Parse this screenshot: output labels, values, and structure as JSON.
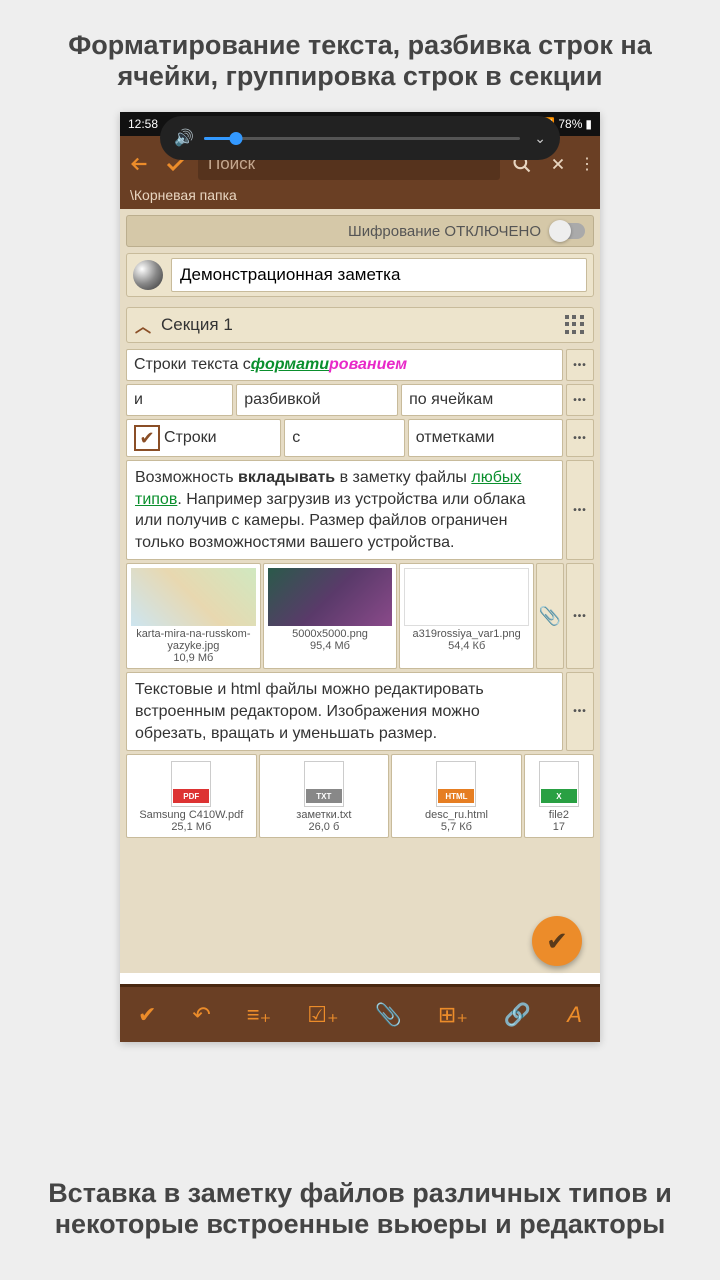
{
  "captions": {
    "top": "Форматирование текста, разбивка строк на ячейки, группировка строк в секции",
    "bottom": "Вставка в заметку файлов различных типов и некоторые встроенные вьюеры и редакторы"
  },
  "statusbar": {
    "time": "12:58",
    "battery": "78%"
  },
  "toolbar": {
    "search_placeholder": "Поиск"
  },
  "breadcrumb": "\\Корневая папка",
  "encryption": {
    "label": "Шифрование ОТКЛЮЧЕНО"
  },
  "note_title": "Демонстрационная заметка",
  "section": {
    "title": "Секция 1"
  },
  "rows": {
    "r1_prefix": "Строки текста с ",
    "r1_fmt1": "формати",
    "r1_fmt2": "рованием",
    "r2_c1": "и",
    "r2_c2": "разбивкой",
    "r2_c3": "по ячейкам",
    "r3_c1": "Строки",
    "r3_c2": "с",
    "r3_c3": "отметками"
  },
  "para1": {
    "p1": "Возможность ",
    "bold": "вкладывать",
    "p2": " в заметку файлы ",
    "link": "любых типов",
    "p3": ". Например загрузив из устройства или облака или получив с камеры. Размер файлов ограничен только возможностями вашего устройства."
  },
  "thumbs": [
    {
      "name": "karta-mira-na-russkom-yazyke.jpg",
      "size": "10,9 Мб"
    },
    {
      "name": "5000x5000.png",
      "size": "95,4 Мб"
    },
    {
      "name": "a319rossiya_var1.png",
      "size": "54,4 Кб"
    }
  ],
  "para2": "Текстовые и html файлы можно редактировать встроенным редактором. Изображения можно обрезать, вращать и уменьшать размер.",
  "files": [
    {
      "name": "Samsung C410W.pdf",
      "size": "25,1 Мб",
      "badge": "PDF"
    },
    {
      "name": "заметки.txt",
      "size": "26,0 б",
      "badge": "TXT"
    },
    {
      "name": "desc_ru.html",
      "size": "5,7 Кб",
      "badge": "HTML"
    },
    {
      "name": "file2",
      "size": "17",
      "badge": "X"
    }
  ]
}
